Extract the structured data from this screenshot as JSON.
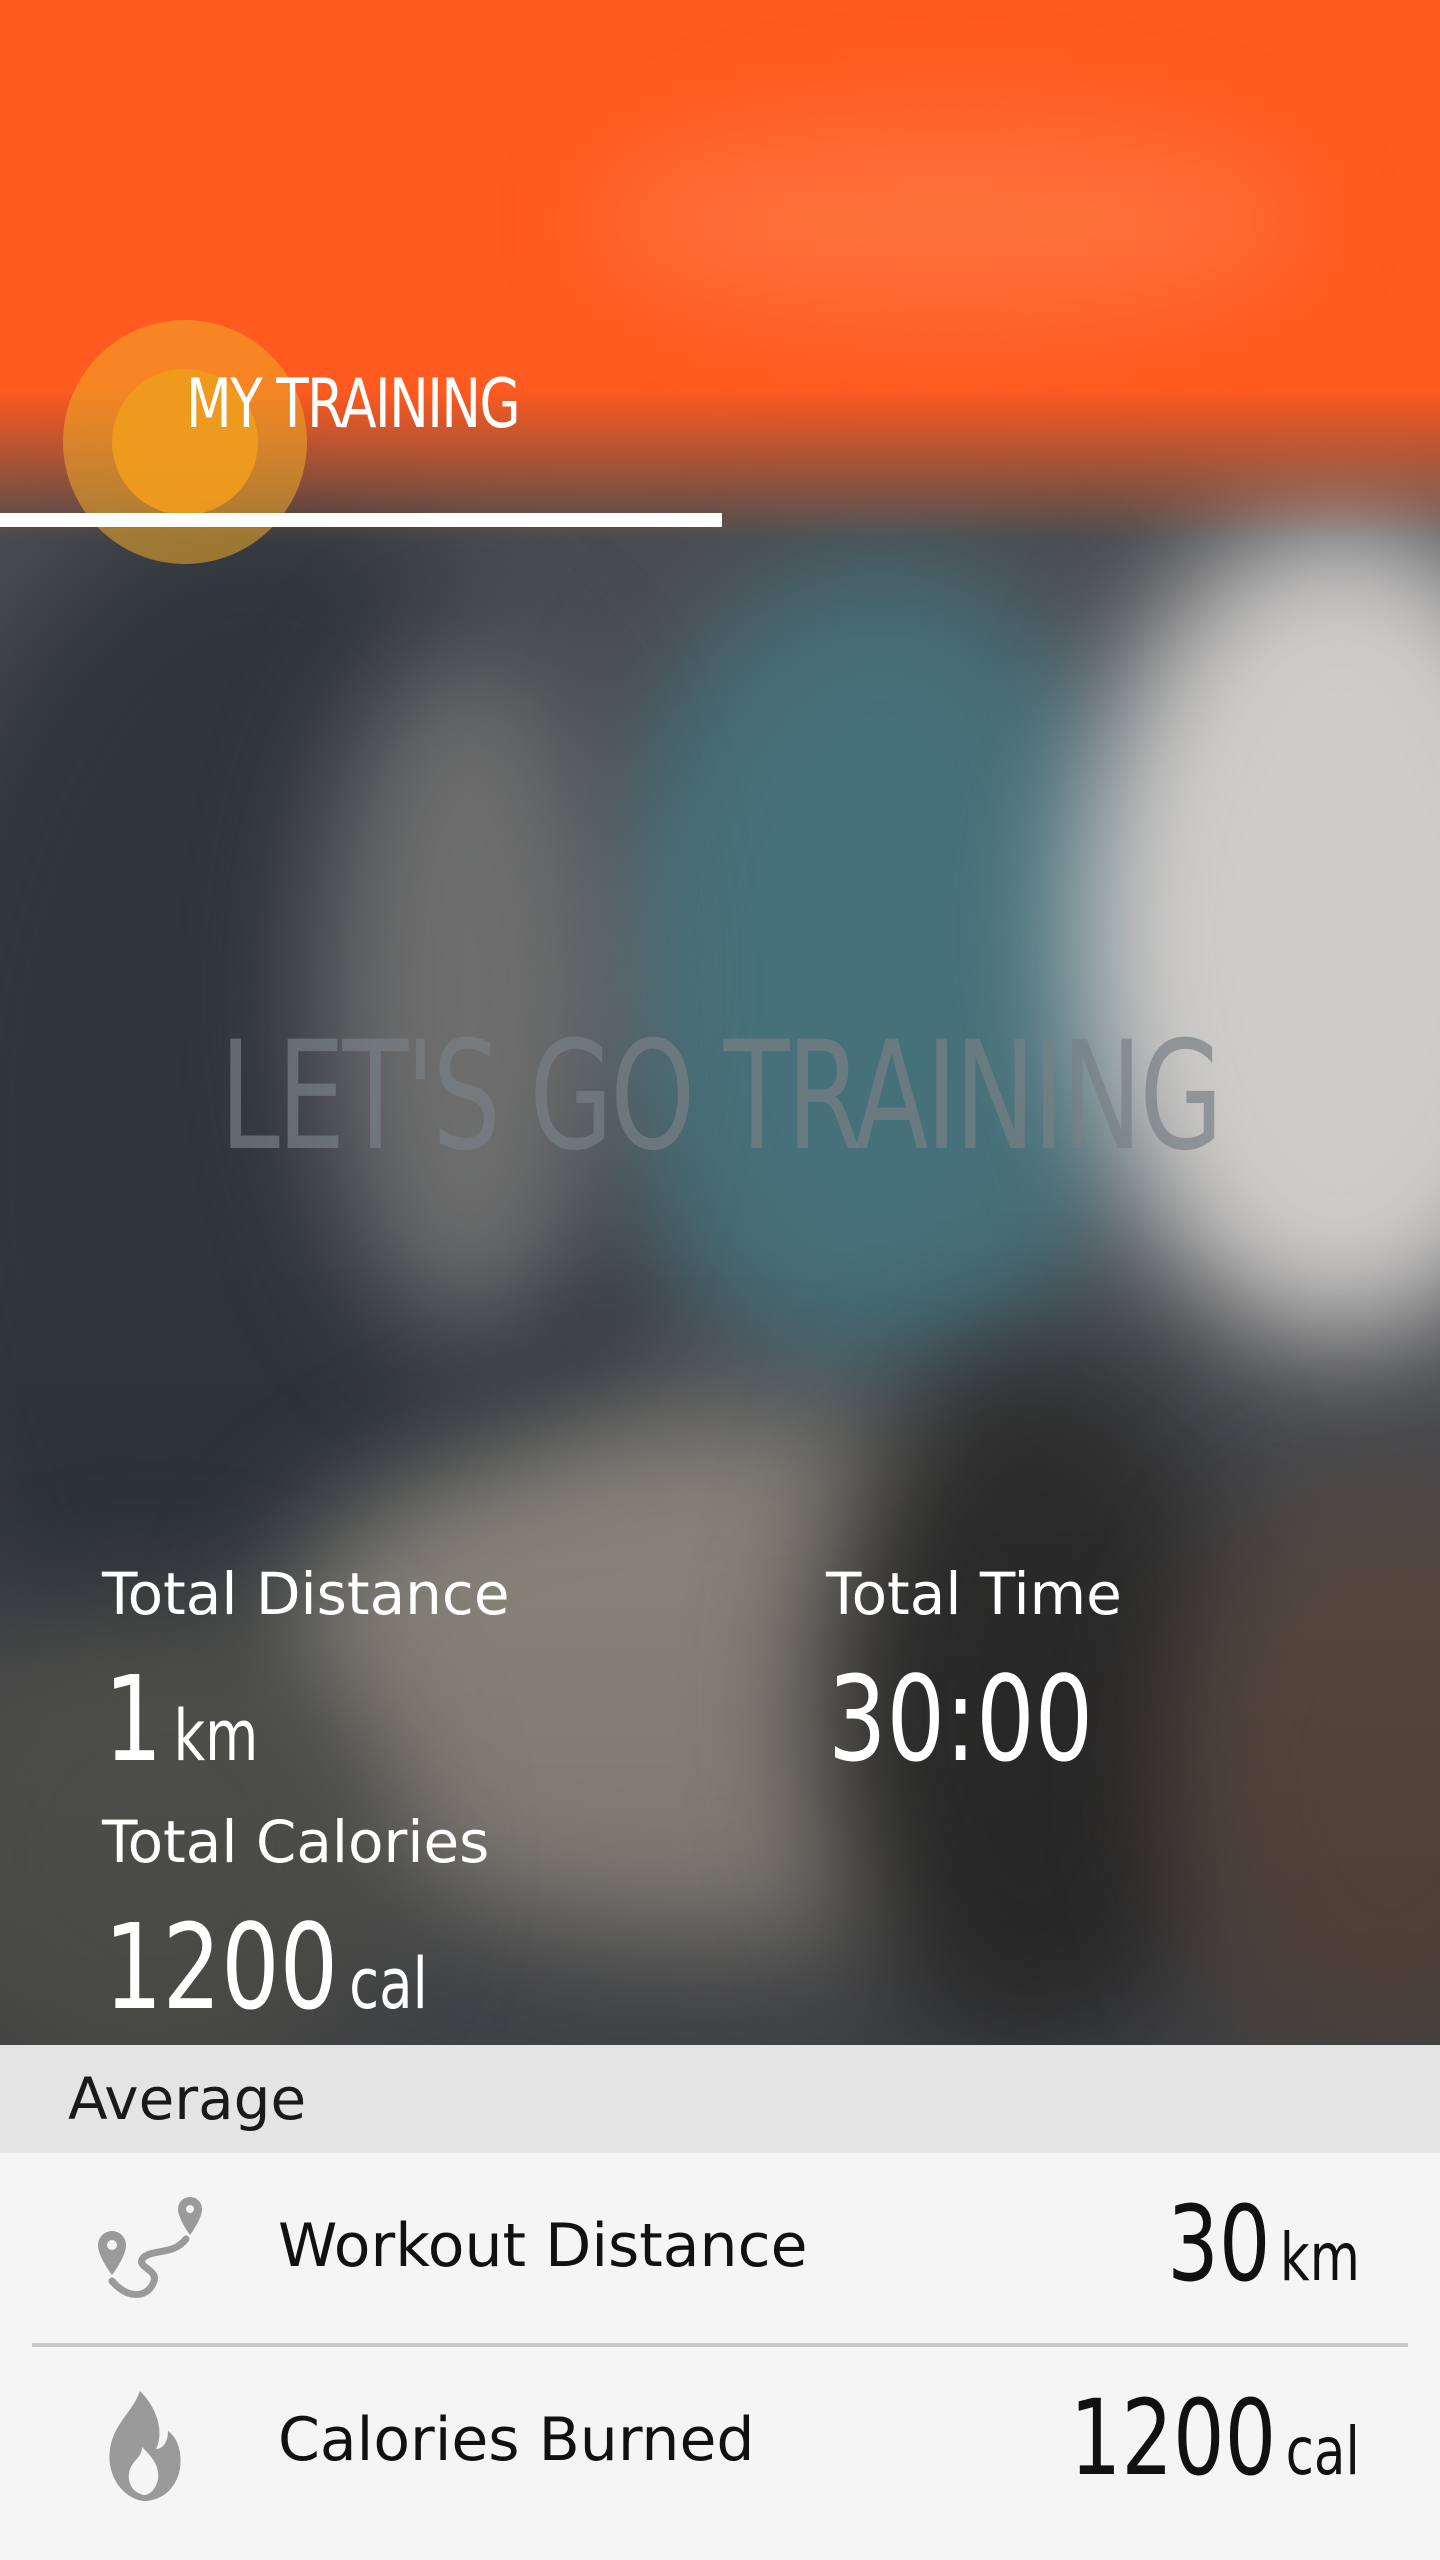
{
  "colors": {
    "accent": "#ff5a1f",
    "touch_ring": "#ee9b1e",
    "section_header_bg": "#e4e4e4",
    "list_bg": "#f5f5f5",
    "icon_gray": "#9a9a9a"
  },
  "header": {
    "title": "MY TRAINING"
  },
  "hero": {
    "tagline": "LET'S GO TRAINING"
  },
  "stats": {
    "total_distance": {
      "label": "Total Distance",
      "value": "1",
      "unit": "km"
    },
    "total_time": {
      "label": "Total Time",
      "value": "30:00"
    },
    "total_calories": {
      "label": "Total Calories",
      "value": "1200",
      "unit": "cal"
    }
  },
  "average": {
    "title": "Average",
    "rows": [
      {
        "icon": "route-icon",
        "label": "Workout Distance",
        "value": "30",
        "unit": "km"
      },
      {
        "icon": "flame-icon",
        "label": "Calories Burned",
        "value": "1200",
        "unit": "cal"
      }
    ]
  }
}
